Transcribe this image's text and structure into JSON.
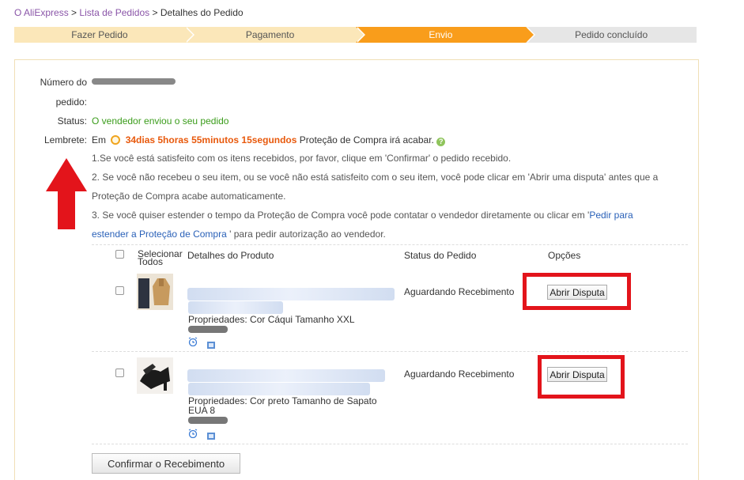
{
  "breadcrumb": {
    "home": "O AliExpress",
    "sep1": " > ",
    "list": "Lista de Pedidos",
    "sep2": " > ",
    "current": "Detalhes do Pedido"
  },
  "steps": [
    {
      "label": "Fazer Pedido",
      "state": "done"
    },
    {
      "label": "Pagamento",
      "state": "done"
    },
    {
      "label": "Envio",
      "state": "active"
    },
    {
      "label": "Pedido concluído",
      "state": "todo"
    }
  ],
  "order_info": {
    "number_label_1": "Número do",
    "number_label_2": "pedido:",
    "status_label": "Status:",
    "status_value": "O vendedor enviou o seu pedido",
    "reminder_label": "Lembrete:",
    "reminder_prefix": "Em",
    "reminder_time": "34dias 5horas 55minutos 15segundos",
    "reminder_suffix": "Proteção de Compra irá acabar.",
    "line1": "1.Se você está satisfeito com os itens recebidos, por favor, clique em 'Confirmar' o pedido recebido.",
    "line2a": "2. Se você não recebeu o seu item, ou se você não está satisfeito com o seu item, você pode clicar em 'Abrir uma disputa' antes que a",
    "line2b": "Proteção de Compra acabe automaticamente.",
    "line3a": "3. Se você quiser estender o tempo da Proteção de Compra você pode contatar o vendedor diretamente ou clicar em '",
    "line3_link_a": "Pedir para",
    "line3_link_b": "estender a Proteção de Compra",
    "line3b": "' para pedir autorização ao vendedor."
  },
  "table": {
    "select_all_1": "Selecionar",
    "select_all_2": "Todos",
    "col_details": "Detalhes do Produto",
    "col_status": "Status do Pedido",
    "col_options": "Opções",
    "rows": [
      {
        "props_1": "Propriedades: Cor Cáqui Tamanho XXL",
        "props_2": "",
        "status": "Aguardando Recebimento",
        "action": "Abrir Disputa"
      },
      {
        "props_1": "Propriedades: Cor preto Tamanho de Sapato",
        "props_2": "EUA 8",
        "status": "Aguardando Recebimento",
        "action": "Abrir Disputa"
      }
    ]
  },
  "confirm_button": "Confirmar o Recebimento",
  "colors": {
    "accent": "#f99d1b",
    "status_green": "#3a9c1a",
    "time_orange": "#e8590c",
    "highlight_red": "#e3141b",
    "link_blue": "#2a61b8"
  }
}
